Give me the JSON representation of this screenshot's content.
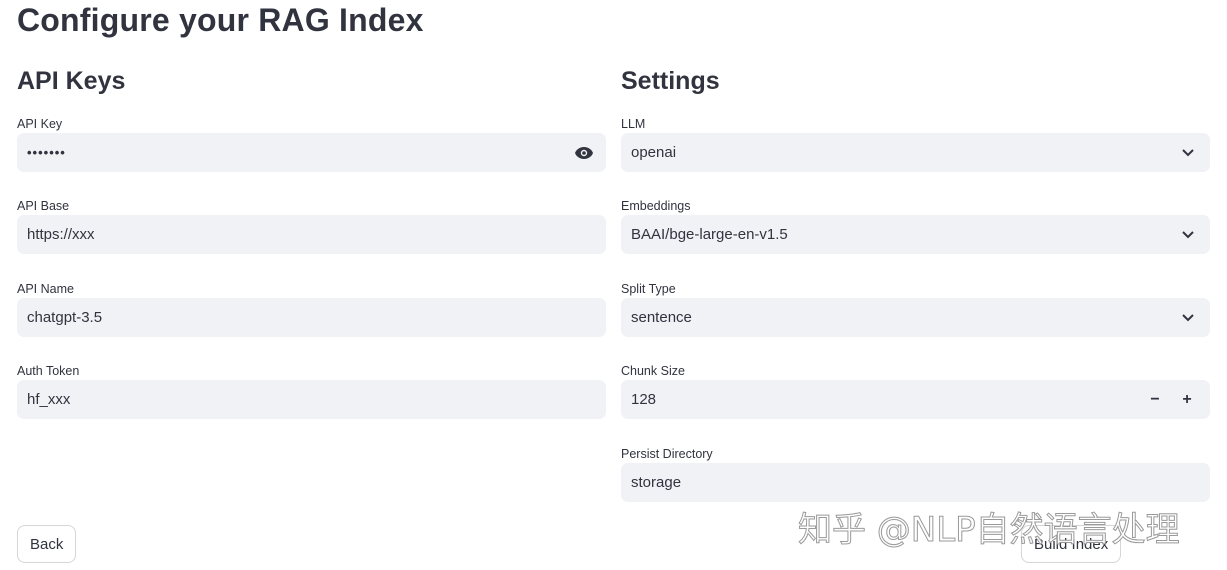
{
  "page": {
    "title": "Configure your RAG Index"
  },
  "api_keys": {
    "title": "API Keys",
    "fields": {
      "api_key": {
        "label": "API Key",
        "value": "•••••••",
        "icon": "eye-icon"
      },
      "api_base": {
        "label": "API Base",
        "value": "https://xxx"
      },
      "api_name": {
        "label": "API Name",
        "value": "chatgpt-3.5"
      },
      "auth_token": {
        "label": "Auth Token",
        "value": "hf_xxx"
      }
    }
  },
  "settings": {
    "title": "Settings",
    "fields": {
      "llm": {
        "label": "LLM",
        "value": "openai",
        "icon": "chevron-down-icon"
      },
      "embeddings": {
        "label": "Embeddings",
        "value": "BAAI/bge-large-en-v1.5",
        "icon": "chevron-down-icon"
      },
      "split_type": {
        "label": "Split Type",
        "value": "sentence",
        "icon": "chevron-down-icon"
      },
      "chunk_size": {
        "label": "Chunk Size",
        "value": "128",
        "minus": "−",
        "plus": "+"
      },
      "persist_directory": {
        "label": "Persist Directory",
        "value": "storage"
      }
    }
  },
  "buttons": {
    "back": "Back",
    "build_index": "Build Index"
  },
  "watermark": {
    "text": "知乎 @NLP自然语言处理"
  }
}
